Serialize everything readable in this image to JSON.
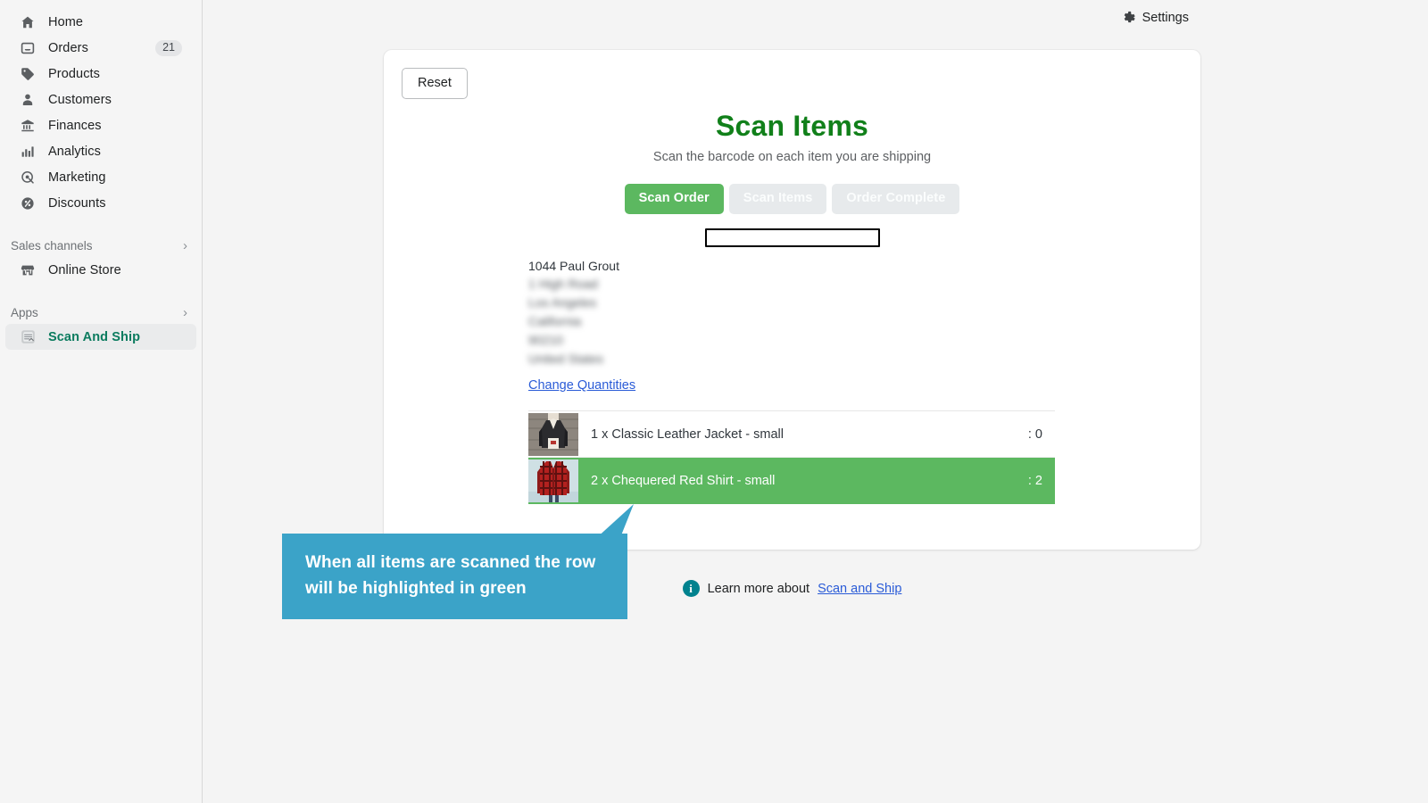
{
  "sidebar": {
    "items": [
      {
        "label": "Home",
        "icon": "home-icon",
        "badge": ""
      },
      {
        "label": "Orders",
        "icon": "orders-icon",
        "badge": "21"
      },
      {
        "label": "Products",
        "icon": "tag-icon",
        "badge": ""
      },
      {
        "label": "Customers",
        "icon": "person-icon",
        "badge": ""
      },
      {
        "label": "Finances",
        "icon": "bank-icon",
        "badge": ""
      },
      {
        "label": "Analytics",
        "icon": "bar-chart-icon",
        "badge": ""
      },
      {
        "label": "Marketing",
        "icon": "megaphone-icon",
        "badge": ""
      },
      {
        "label": "Discounts",
        "icon": "percent-icon",
        "badge": ""
      }
    ],
    "sections": [
      {
        "label": "Sales channels",
        "chevron": "›"
      },
      {
        "label": "Apps",
        "chevron": "›"
      }
    ],
    "online_store": {
      "label": "Online Store",
      "icon": "store-icon"
    },
    "app_item": {
      "label": "Scan And Ship",
      "icon": "scan-app-icon"
    },
    "active_item": "Scan And Ship",
    "active_color": "#0b7b5e"
  },
  "topbar": {
    "settings_label": "Settings",
    "settings_icon": "gear-icon"
  },
  "card": {
    "reset_label": "Reset",
    "title": "Scan Items",
    "title_color": "#11801a",
    "subtitle": "Scan the barcode on each item you are shipping",
    "steps": [
      {
        "label": "Scan Order",
        "state": "active"
      },
      {
        "label": "Scan Items",
        "state": "disabled"
      },
      {
        "label": "Order Complete",
        "state": "disabled"
      }
    ],
    "active_step_color": "#5cb860",
    "scan_input": {
      "value": "",
      "placeholder": ""
    },
    "address": {
      "name": "1044 Paul Grout",
      "lines": [
        "1 High Road",
        "Los Angeles",
        "California",
        "90210",
        "United States"
      ],
      "redacted": true
    },
    "change_quantities_label": "Change Quantities",
    "items": [
      {
        "label": "1 x Classic Leather Jacket - small",
        "count": ": 0",
        "scanned": false,
        "thumb": "classic-leather-jacket-thumb"
      },
      {
        "label": "2 x Chequered Red Shirt - small",
        "count": ": 2",
        "scanned": true,
        "thumb": "chequered-red-shirt-thumb"
      }
    ],
    "row_complete_color": "#5cb860"
  },
  "footer": {
    "info_icon": "info-icon",
    "text": "Learn more about",
    "link_label": "Scan and Ship"
  },
  "callout": {
    "text": "When all items are scanned the row will be highlighted in green",
    "color": "#3ba3c8"
  }
}
